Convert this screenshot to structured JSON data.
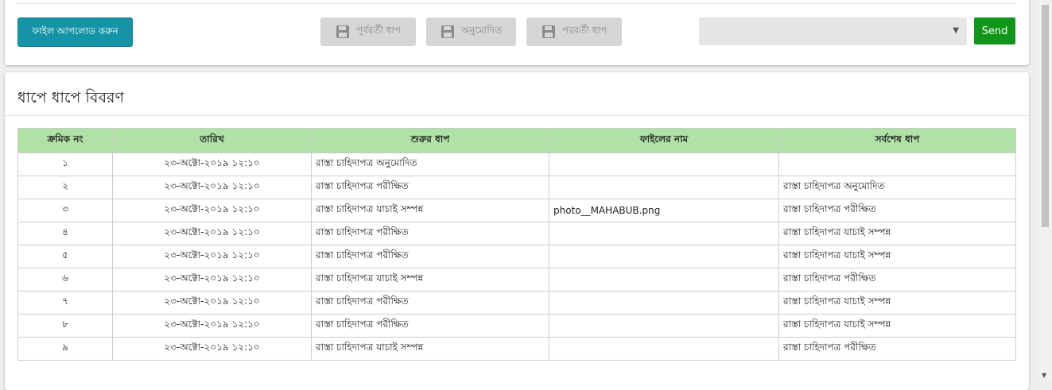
{
  "toolbar": {
    "upload_label": "ফাইল আপলোড করুন",
    "prev_label": "পূর্ববর্তী ধাপ",
    "approve_label": "অনুমোদিত",
    "next_label": "পরবর্তী ধাপ",
    "select_value": "",
    "send_label": "Send"
  },
  "section": {
    "title": "ধাপে ধাপে বিবরণ"
  },
  "table": {
    "headers": [
      "ক্রমিক নং",
      "তারিখ",
      "শুরুর ধাপ",
      "ফাইলের নাম",
      "সর্বশেষ ধাপ"
    ],
    "rows": [
      [
        "১",
        "২৩-অক্টো-২০১৯ ১২:১০",
        "রাস্তা চাহিদাপত্র অনুমোদিত",
        "",
        ""
      ],
      [
        "২",
        "২৩-অক্টো-২০১৯ ১২:১০",
        "রাস্তা চাহিদাপত্র পরীক্ষিত",
        "",
        "রাস্তা চাহিদাপত্র অনুমোদিত"
      ],
      [
        "৩",
        "২৩-অক্টো-২০১৯ ১২:১০",
        "রাস্তা চাহিদাপত্র যাচাই সম্পন্ন",
        "photo__MAHABUB.png",
        "রাস্তা চাহিদাপত্র পরীক্ষিত"
      ],
      [
        "৪",
        "২৩-অক্টো-২০১৯ ১২:১০",
        "রাস্তা চাহিদাপত্র পরীক্ষিত",
        "",
        "রাস্তা চাহিদাপত্র যাচাই সম্পন্ন"
      ],
      [
        "৫",
        "২৩-অক্টো-২০১৯ ১২:১০",
        "রাস্তা চাহিদাপত্র পরীক্ষিত",
        "",
        "রাস্তা চাহিদাপত্র যাচাই সম্পন্ন"
      ],
      [
        "৬",
        "২৩-অক্টো-২০১৯ ১২:১০",
        "রাস্তা চাহিদাপত্র যাচাই সম্পন্ন",
        "",
        "রাস্তা চাহিদাপত্র পরীক্ষিত"
      ],
      [
        "৭",
        "২৩-অক্টো-২০১৯ ১২:১০",
        "রাস্তা চাহিদাপত্র পরীক্ষিত",
        "",
        "রাস্তা চাহিদাপত্র যাচাই সম্পন্ন"
      ],
      [
        "৮",
        "২৩-অক্টো-২০১৯ ১২:১০",
        "রাস্তা চাহিদাপত্র পরীক্ষিত",
        "",
        "রাস্তা চাহিদাপত্র যাচাই সম্পন্ন"
      ],
      [
        "৯",
        "২৩-অক্টো-২০১৯ ১২:১০",
        "রাস্তা চাহিদাপত্র যাচাই সম্পন্ন",
        "",
        "রাস্তা চাহিদাপত্র পরীক্ষিত"
      ]
    ]
  },
  "icons": {
    "save": "save-icon",
    "dropdown": "chevron-down-icon"
  },
  "colors": {
    "upload": "#1694a7",
    "send": "#109618",
    "header_bg": "#b0e2a6",
    "disabled": "#d6d6d6"
  }
}
